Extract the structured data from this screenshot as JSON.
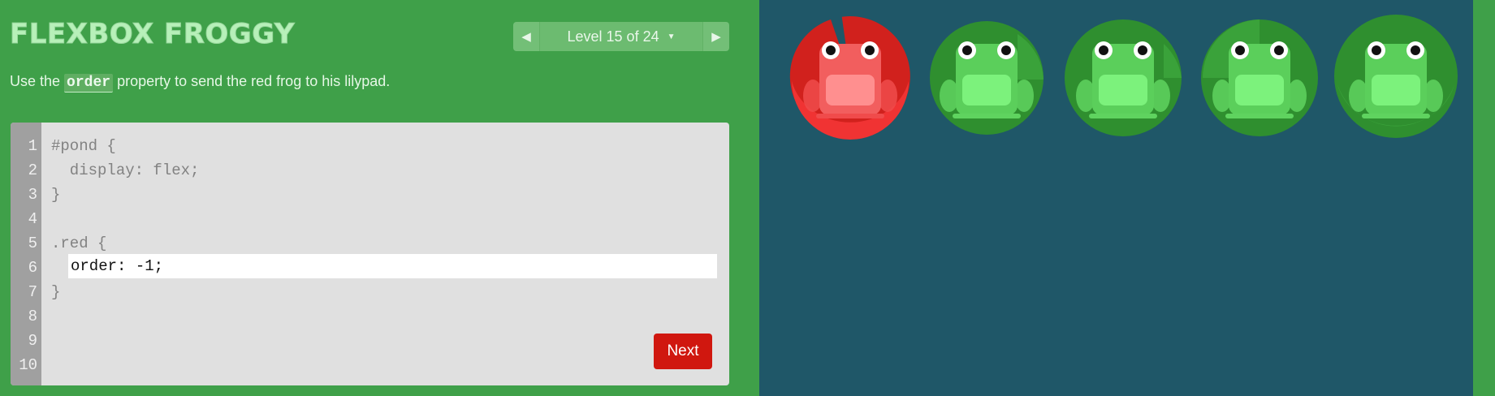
{
  "app": {
    "title": "FLEXBOX FROGGY"
  },
  "level_nav": {
    "prev_icon": "triangle-left-icon",
    "next_icon": "triangle-right-icon",
    "level_text": "Level 15 of 24",
    "dropdown_icon": "caret-down-icon"
  },
  "instructions": {
    "before": "Use the ",
    "code": "order",
    "after": " property to send the red frog to his lilypad."
  },
  "editor": {
    "line_numbers": [
      "1",
      "2",
      "3",
      "4",
      "5",
      "6",
      "7",
      "8",
      "9",
      "10"
    ],
    "lines": [
      "#pond {",
      "  display: flex;",
      "}",
      "",
      ".red {",
      "",
      "}",
      "",
      "",
      ""
    ],
    "input_value": "order: -1;",
    "next_label": "Next"
  },
  "pond": {
    "lilypads": [
      "red",
      "green",
      "green",
      "green",
      "green"
    ],
    "frogs": [
      "red",
      "green",
      "green",
      "green",
      "green"
    ]
  },
  "colors": {
    "page_green": "#3fa049",
    "pond_blue": "#1f5768",
    "red_pad": "#d1211d",
    "red_frog": "#f04b4b",
    "green_pad": "#2f8f2f",
    "green_frog": "#5fd35f",
    "next_button": "#d0170f"
  }
}
